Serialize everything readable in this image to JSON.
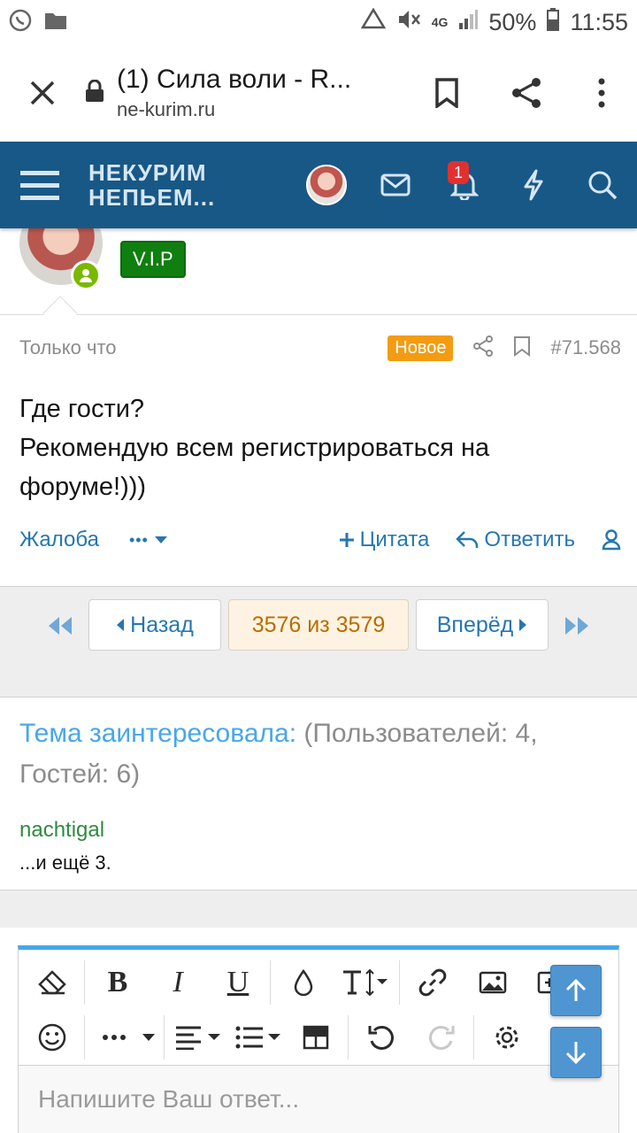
{
  "statusbar": {
    "battery": "50%",
    "time": "11:55",
    "network": "4G"
  },
  "browser": {
    "title": "(1) Сила воли - R...",
    "domain": "ne-kurim.ru"
  },
  "site": {
    "logo_line1": "НЕКУРИМ",
    "logo_line2": "НЕПЬЕМ...",
    "alerts_count": "1"
  },
  "post": {
    "user_badge": "V.I.P",
    "time": "Только что",
    "new_label": "Новое",
    "number": "#71.568",
    "body_line1": "Где гости?",
    "body_line2": "Рекомендую всем регистрироваться на форуме!)))",
    "actions": {
      "report": "Жалоба",
      "more": "•••",
      "quote": "Цитата",
      "reply": "Ответить"
    }
  },
  "pagination": {
    "prev": "Назад",
    "current": "3576 из 3579",
    "next": "Вперёд"
  },
  "viewers": {
    "title": "Тема заинтересовала:",
    "counts": "(Пользователей: 4, Гостей: 6)",
    "user": "nachtigal",
    "more": "...и ещё 3."
  },
  "editor": {
    "placeholder": "Напишите Ваш ответ..."
  },
  "colors": {
    "header": "#185886",
    "link": "#2577b1",
    "new_badge": "#f39c12",
    "vip": "#0f7f0f",
    "accent": "#47a7eb"
  }
}
